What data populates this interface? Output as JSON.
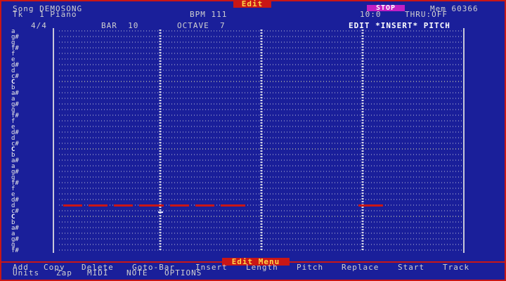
{
  "header": {
    "tab_title": "Edit",
    "song_label": "Song DEMOSONG",
    "track_label": "Tk   1 Piano",
    "bpm": "BPM 111",
    "transport": "STOP",
    "mem": "Mem 60366",
    "position": "10:0",
    "thru": "THRU:OFF"
  },
  "infobar": {
    "time_sig": "4/4",
    "bar": "BAR  10",
    "octave": "OCTAVE  7",
    "mode": "EDIT *INSERT* PITCH"
  },
  "pitch_labels": [
    "a",
    "g#",
    "g",
    "f#",
    "f",
    "e",
    "d#",
    "d",
    "c#",
    "C",
    "b",
    "a#",
    "a",
    "g#",
    "g",
    "f#",
    "f",
    "e",
    "d#",
    "d",
    "c#",
    "C",
    "b",
    "a#",
    "a",
    "g#",
    "g",
    "f#",
    "f",
    "e",
    "d#",
    "d",
    "c#",
    "C",
    "b",
    "a#",
    "a",
    "g#",
    "g",
    "f#"
  ],
  "notes": [
    {
      "start": 0,
      "length": 7
    },
    {
      "start": 9,
      "length": 7
    },
    {
      "start": 18,
      "length": 7
    },
    {
      "start": 27,
      "length": 9
    },
    {
      "start": 38,
      "length": 7
    },
    {
      "start": 47,
      "length": 7
    },
    {
      "start": 56,
      "length": 9
    },
    {
      "start": 105,
      "length": 9
    }
  ],
  "footer": {
    "menu_tab": "Edit Menu",
    "row1": [
      "Add",
      "Copy",
      "Delete",
      "Goto-Bar",
      "Insert",
      "Length",
      "Pitch",
      "Replace",
      "Start",
      "Track"
    ],
    "row2": [
      "Units",
      "Zap",
      "MIDI",
      "NOTE",
      "OPTIONS"
    ]
  },
  "colors": {
    "background": "#1a1f9a",
    "frame": "#c91616",
    "note": "#c91616",
    "stop_highlight": "#c21fc4",
    "tab_text": "#ffd84a"
  }
}
